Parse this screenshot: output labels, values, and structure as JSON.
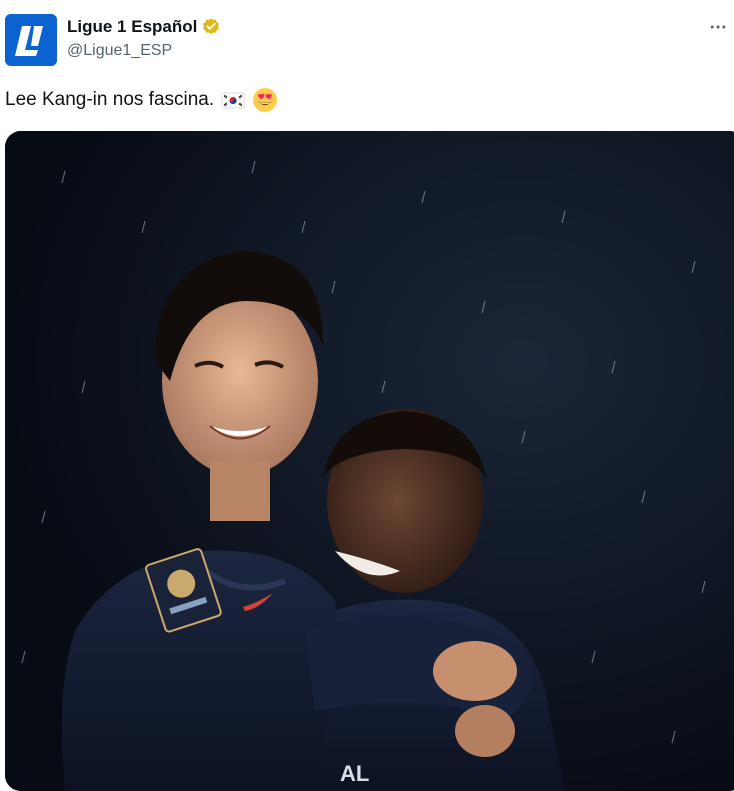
{
  "account": {
    "display_name": "Ligue 1 Español",
    "handle": "@Ligue1_ESP",
    "verified": true,
    "avatar_icon": "ligue1-logo-icon",
    "avatar_color": "#0b63d1",
    "verified_color": "#e2b719"
  },
  "tweet": {
    "text": "Lee Kang-in nos fascina.",
    "emojis": [
      "south-korea-flag-icon",
      "heart-eyes-emoji-icon"
    ]
  },
  "menu": {
    "icon": "more-options-icon"
  },
  "media": {
    "kind": "photo",
    "jersey_text": "AL"
  }
}
